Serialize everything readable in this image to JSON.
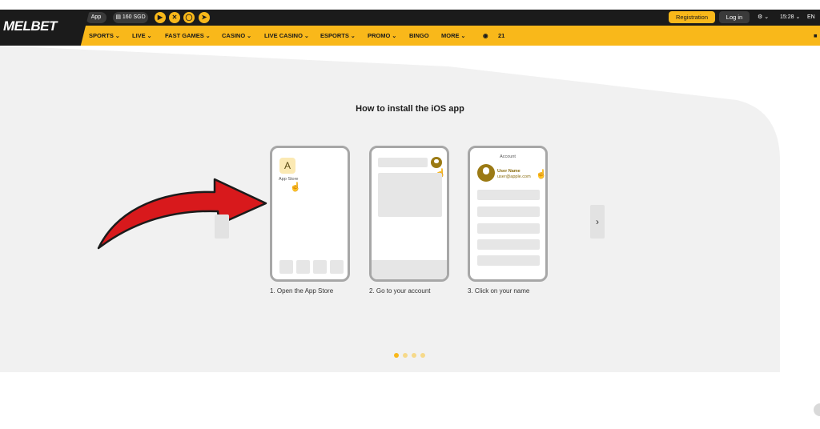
{
  "header": {
    "app_label": "App",
    "bonus_label": "160 SGD",
    "social_icons": [
      "play-icon",
      "x-icon",
      "instagram-icon",
      "telegram-icon"
    ],
    "registration_label": "Registration",
    "login_label": "Log in",
    "time": "15:28",
    "language": "EN"
  },
  "brand": {
    "logo_text": "MELBET",
    "accent_color": "#f9b81a",
    "dark_color": "#1b1b1b"
  },
  "nav": {
    "items": [
      {
        "label": "SPORTS",
        "dropdown": true
      },
      {
        "label": "LIVE",
        "dropdown": true
      },
      {
        "label": "FAST GAMES",
        "dropdown": true
      },
      {
        "label": "CASINO",
        "dropdown": true
      },
      {
        "label": "LIVE CASINO",
        "dropdown": true
      },
      {
        "label": "ESPORTS",
        "dropdown": true
      },
      {
        "label": "PROMO",
        "dropdown": true
      },
      {
        "label": "BINGO",
        "dropdown": false
      },
      {
        "label": "MORE",
        "dropdown": true
      }
    ],
    "android_count": "21"
  },
  "main": {
    "title": "How to install the iOS app",
    "steps": [
      {
        "caption": "1. Open the App Store",
        "icon_label": "App Store"
      },
      {
        "caption": "2. Go to your account"
      },
      {
        "caption": "3. Click on your name",
        "account_title": "Account",
        "user_name": "User Name",
        "user_email": "user@apple.com"
      }
    ],
    "pagination_total": 4,
    "pagination_active": 0
  }
}
